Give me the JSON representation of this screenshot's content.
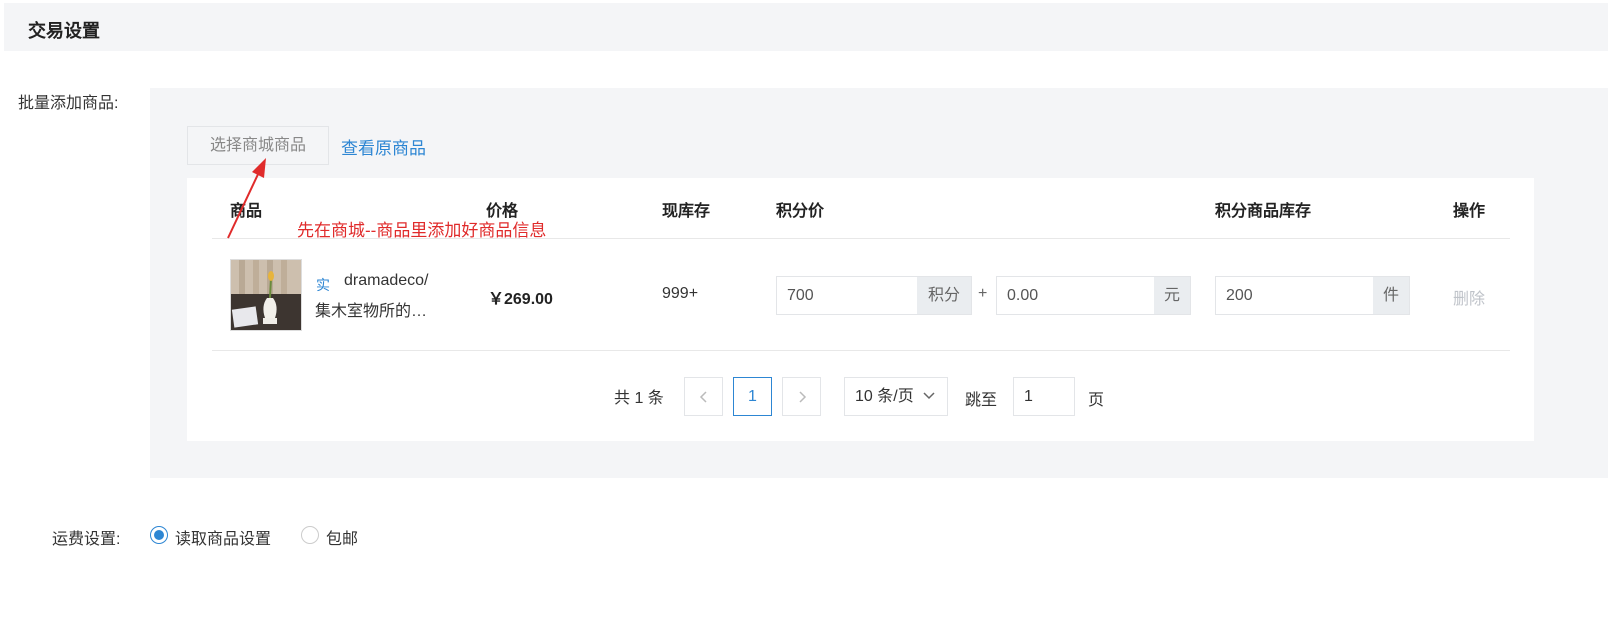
{
  "header": {
    "title": "交易设置"
  },
  "form": {
    "batch_label": "批量添加商品:",
    "shipping_label": "运费设置:"
  },
  "toolbar": {
    "select_button": "选择商城商品",
    "view_link": "查看原商品"
  },
  "annotation": {
    "text": "先在商城--商品里添加好商品信息",
    "color": "#e02b2b"
  },
  "table": {
    "columns": {
      "product": "商品",
      "price": "价格",
      "stock": "现库存",
      "points_price": "积分价",
      "points_stock": "积分商品库存",
      "action": "操作"
    },
    "rows": [
      {
        "tag": "实",
        "name_line1": "dramadeco/",
        "name_line2": "集木室物所的…",
        "price": "￥269.00",
        "stock": "999+",
        "points": "700",
        "points_unit": "积分",
        "plus": "+",
        "cash": "0.00",
        "cash_unit": "元",
        "points_stock": "200",
        "points_stock_unit": "件",
        "delete": "删除"
      }
    ]
  },
  "pagination": {
    "total": "共 1 条",
    "current": "1",
    "page_size": "10 条/页",
    "jump_label": "跳至",
    "jump_value": "1",
    "page_suffix": "页"
  },
  "shipping": {
    "options": [
      {
        "label": "读取商品设置",
        "selected": true
      },
      {
        "label": "包邮",
        "selected": false
      }
    ]
  },
  "colors": {
    "accent": "#2d86d3",
    "panel_bg": "#f4f5f7"
  }
}
